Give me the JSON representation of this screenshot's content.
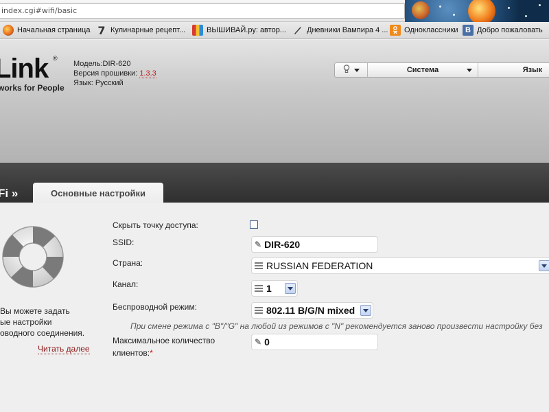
{
  "browser": {
    "address": "index.cgi#wifi/basic"
  },
  "bookmarks": [
    {
      "icon": "firefox-icon",
      "label": "Начальная страница"
    },
    {
      "icon": "seven-icon",
      "glyph": "7",
      "label": "Кулинарные рецепт..."
    },
    {
      "icon": "vyshivai-icon",
      "label": "ВЫШИВАЙ.ру: автор..."
    },
    {
      "icon": "knife-icon",
      "label": "Дневники Вампира 4 ..."
    },
    {
      "icon": "odnoklassniki-icon",
      "label": "Одноклассники"
    },
    {
      "icon": "vk-icon",
      "glyph": "В",
      "label": "Добро пожаловать"
    }
  ],
  "router": {
    "logo_text": "Link",
    "logo_reg": "®",
    "slogan": "works for People",
    "model_label": "Модель:",
    "model": "DIR-620",
    "firmware_label": "Версия прошивки:",
    "firmware": "1.3.3",
    "language_label": "Язык:",
    "language": "Русский"
  },
  "topmenu": {
    "system": "Система",
    "language": "Язык"
  },
  "breadcrumb": "Fi »",
  "tab_basic": "Основные настройки",
  "help": {
    "line1": "Вы можете задать",
    "line2": "ые настройки",
    "line3": "оводного соединения.",
    "more": "Читать далее"
  },
  "form": {
    "hide_ap_label": "Скрыть точку доступа:",
    "hide_ap_checked": false,
    "ssid_label": "SSID:",
    "ssid_value": "DIR-620",
    "country_label": "Страна:",
    "country_value": "RUSSIAN FEDERATION",
    "channel_label": "Канал:",
    "channel_value": "1",
    "mode_label": "Беспроводной режим:",
    "mode_value": "802.11 B/G/N mixed",
    "mode_note": "При смене режима с \"B\"/\"G\" на любой из режимов с \"N\" рекомендуется заново произвести настройку без",
    "max_clients_label_1": "Максимальное количество",
    "max_clients_label_2": "клиентов:",
    "max_clients_required": "*",
    "max_clients_value": "0"
  }
}
